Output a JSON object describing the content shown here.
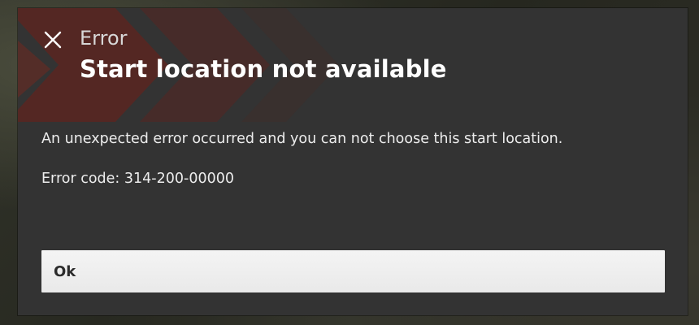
{
  "dialog": {
    "kicker": "Error",
    "title": "Start location not available",
    "message": "An unexpected error occurred and you can not choose this start location.",
    "error_code": "Error code: 314-200-00000",
    "ok_label": "Ok",
    "close_icon": "close-icon"
  },
  "colors": {
    "dialog_bg": "#333333",
    "accent": "#7a2a22",
    "button_bg": "#efefef",
    "text": "#ededed"
  }
}
